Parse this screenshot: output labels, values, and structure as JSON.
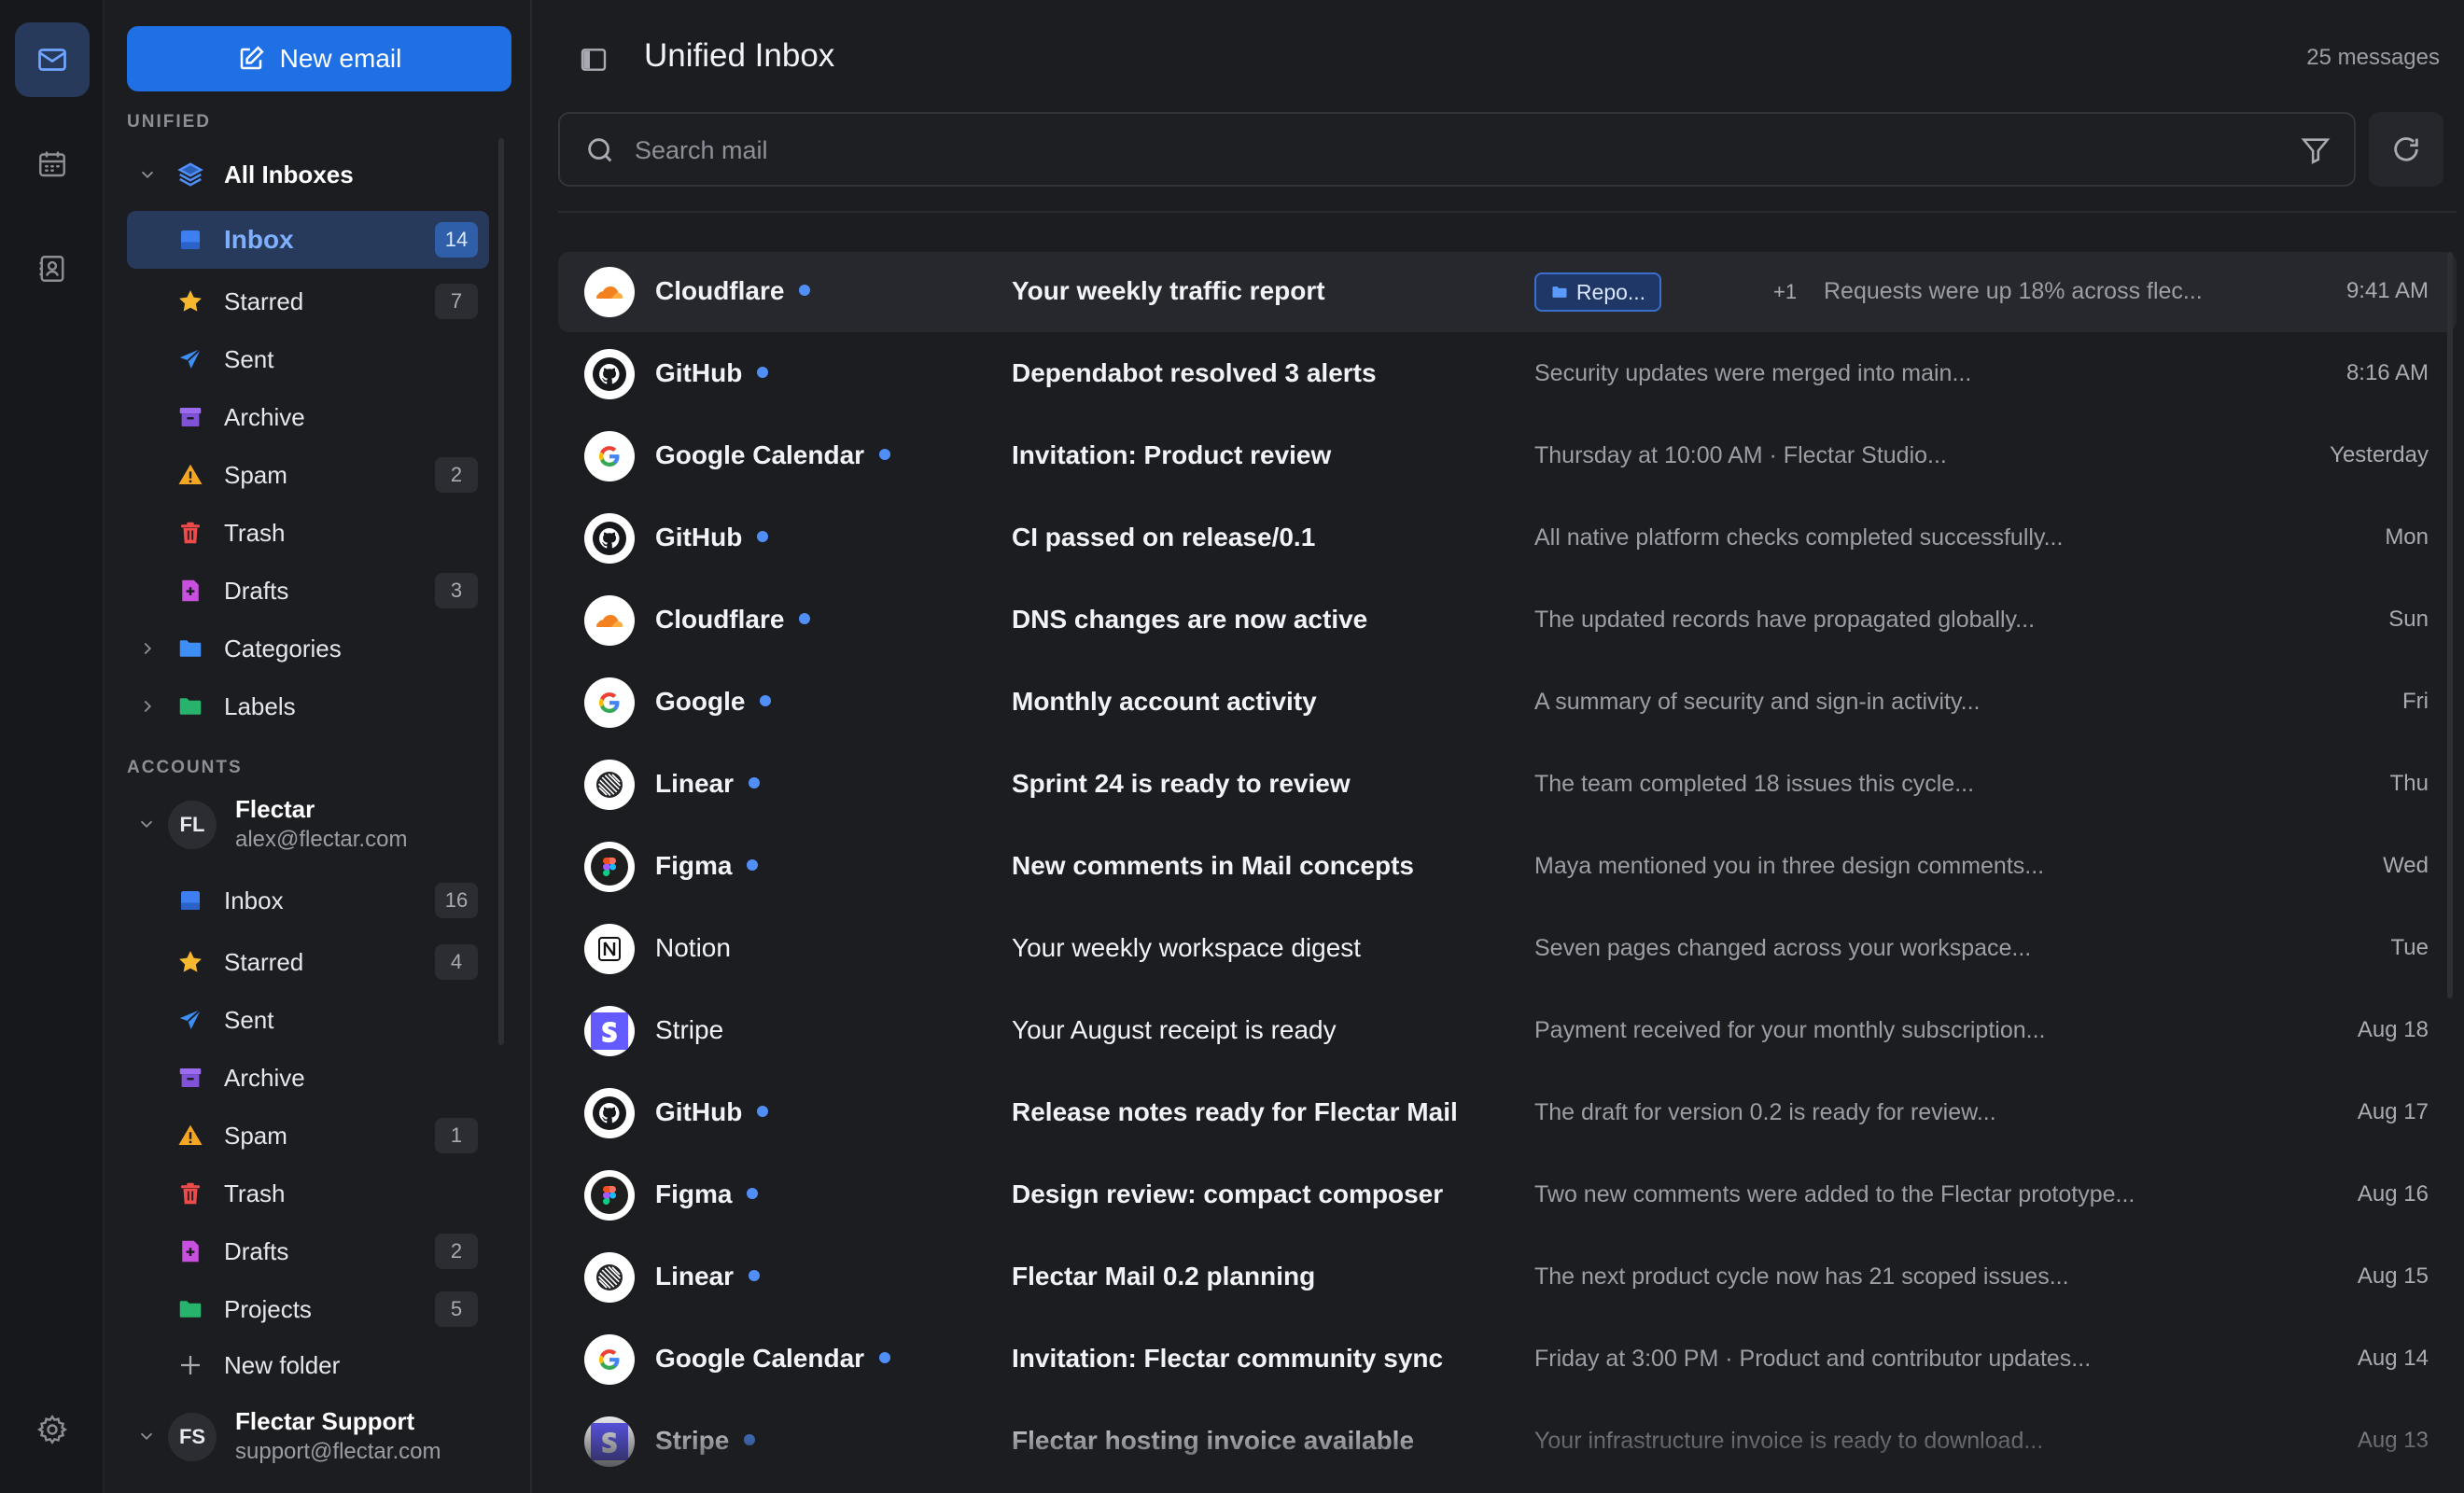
{
  "app": {
    "title": "Unified Inbox",
    "message_count": "25 messages",
    "new_email_label": "New email",
    "search_placeholder": "Search mail"
  },
  "colors": {
    "accent": "#1f6fe5",
    "selected_bg": "#283a5c",
    "unread_dot": "#4f8ff7"
  },
  "rail": [
    {
      "name": "mail-icon",
      "active": true
    },
    {
      "name": "calendar-icon",
      "active": false
    },
    {
      "name": "contacts-icon",
      "active": false
    },
    {
      "name": "settings-icon",
      "active": false
    }
  ],
  "sidebar": {
    "unified_label": "UNIFIED",
    "all_inboxes": "All Inboxes",
    "unified_items": [
      {
        "label": "Inbox",
        "icon": "inbox-icon",
        "count": "14"
      },
      {
        "label": "Starred",
        "icon": "star-icon",
        "count": "7"
      },
      {
        "label": "Sent",
        "icon": "send-icon",
        "count": ""
      },
      {
        "label": "Archive",
        "icon": "archive-icon",
        "count": ""
      },
      {
        "label": "Spam",
        "icon": "warning-icon",
        "count": "2"
      },
      {
        "label": "Trash",
        "icon": "trash-icon",
        "count": ""
      },
      {
        "label": "Drafts",
        "icon": "drafts-icon",
        "count": "3"
      },
      {
        "label": "Categories",
        "icon": "category-folder-icon",
        "count": ""
      },
      {
        "label": "Labels",
        "icon": "label-folder-icon",
        "count": ""
      }
    ],
    "accounts_label": "ACCOUNTS",
    "accounts": [
      {
        "initials": "FL",
        "name": "Flectar",
        "email": "alex@flectar.com"
      },
      {
        "initials": "FS",
        "name": "Flectar Support",
        "email": "support@flectar.com"
      }
    ],
    "account_items": [
      {
        "label": "Inbox",
        "icon": "inbox-icon",
        "count": "16"
      },
      {
        "label": "Starred",
        "icon": "star-icon",
        "count": "4"
      },
      {
        "label": "Sent",
        "icon": "send-icon",
        "count": ""
      },
      {
        "label": "Archive",
        "icon": "archive-icon",
        "count": ""
      },
      {
        "label": "Spam",
        "icon": "warning-icon",
        "count": "1"
      },
      {
        "label": "Trash",
        "icon": "trash-icon",
        "count": ""
      },
      {
        "label": "Drafts",
        "icon": "drafts-icon",
        "count": "2"
      },
      {
        "label": "Projects",
        "icon": "folder-icon",
        "count": "5"
      },
      {
        "label": "New folder",
        "icon": "plus-icon",
        "count": ""
      }
    ]
  },
  "emails": [
    {
      "sender": "Cloudflare",
      "logo": "cloudflare",
      "unread": true,
      "subject": "Your weekly traffic report",
      "tag": "Repo...",
      "extra": "+1",
      "preview": "Requests were up 18% across flec...",
      "date": "9:41 AM"
    },
    {
      "sender": "GitHub",
      "logo": "github",
      "unread": true,
      "subject": "Dependabot resolved 3 alerts",
      "preview": "Security updates were merged into main...",
      "date": "8:16 AM"
    },
    {
      "sender": "Google Calendar",
      "logo": "google",
      "unread": true,
      "subject": "Invitation: Product review",
      "preview": "Thursday at 10:00 AM · Flectar Studio...",
      "date": "Yesterday"
    },
    {
      "sender": "GitHub",
      "logo": "github",
      "unread": true,
      "subject": "CI passed on release/0.1",
      "preview": "All native platform checks completed successfully...",
      "date": "Mon"
    },
    {
      "sender": "Cloudflare",
      "logo": "cloudflare",
      "unread": true,
      "subject": "DNS changes are now active",
      "preview": "The updated records have propagated globally...",
      "date": "Sun"
    },
    {
      "sender": "Google",
      "logo": "google",
      "unread": true,
      "subject": "Monthly account activity",
      "preview": "A summary of security and sign-in activity...",
      "date": "Fri"
    },
    {
      "sender": "Linear",
      "logo": "linear",
      "unread": true,
      "subject": "Sprint 24 is ready to review",
      "preview": "The team completed 18 issues this cycle...",
      "date": "Thu"
    },
    {
      "sender": "Figma",
      "logo": "figma",
      "unread": true,
      "subject": "New comments in Mail concepts",
      "preview": "Maya mentioned you in three design comments...",
      "date": "Wed"
    },
    {
      "sender": "Notion",
      "logo": "notion",
      "unread": false,
      "subject": "Your weekly workspace digest",
      "preview": "Seven pages changed across your workspace...",
      "date": "Tue"
    },
    {
      "sender": "Stripe",
      "logo": "stripe",
      "unread": false,
      "subject": "Your August receipt is ready",
      "preview": "Payment received for your monthly subscription...",
      "date": "Aug 18"
    },
    {
      "sender": "GitHub",
      "logo": "github",
      "unread": true,
      "subject": "Release notes ready for Flectar Mail",
      "preview": "The draft for version 0.2 is ready for review...",
      "date": "Aug 17"
    },
    {
      "sender": "Figma",
      "logo": "figma",
      "unread": true,
      "subject": "Design review: compact composer",
      "preview": "Two new comments were added to the Flectar prototype...",
      "date": "Aug 16"
    },
    {
      "sender": "Linear",
      "logo": "linear",
      "unread": true,
      "subject": "Flectar Mail 0.2 planning",
      "preview": "The next product cycle now has 21 scoped issues...",
      "date": "Aug 15"
    },
    {
      "sender": "Google Calendar",
      "logo": "google",
      "unread": true,
      "subject": "Invitation: Flectar community sync",
      "preview": "Friday at 3:00 PM · Product and contributor updates...",
      "date": "Aug 14"
    },
    {
      "sender": "Stripe",
      "logo": "stripe",
      "unread": true,
      "subject": "Flectar hosting invoice available",
      "preview": "Your infrastructure invoice is ready to download...",
      "date": "Aug 13"
    }
  ]
}
